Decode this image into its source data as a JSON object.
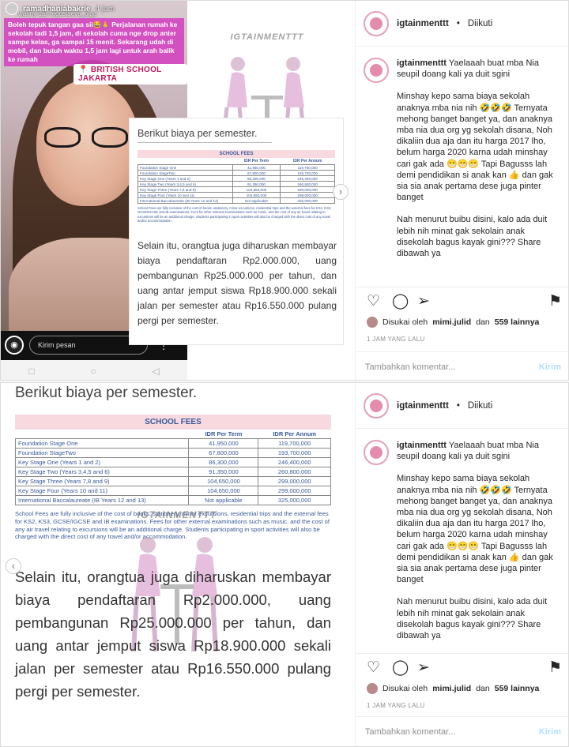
{
  "story": {
    "username": "ramadhaniabakrie",
    "time": "4 jam",
    "tagged": "wanny dan legostaeva_olga",
    "caption": "Boleh tepuk tangan gaa sii😂🙏 Perjalanan rumah ke sekolah tadi 1,5 jam, di sekolah cuma nge drop anter sampe kelas, ga sampai 15 menit. Sekarang udah di mobil, dan butuh waktu 1,5 jam lagi untuk arah balik ke rumah",
    "location": "📍 BRITISH SCHOOL JAKARTA",
    "message_placeholder": "Kirim pesan",
    "camera_icon": "◉",
    "more_icon": "⋮",
    "nav_back": "◁",
    "nav_home": "○",
    "nav_recent": "□"
  },
  "doc": {
    "heading": "Berikut biaya per semester.",
    "fees_title": "SCHOOL FEES",
    "col_term": "IDR Per Term",
    "col_annum": "IDR Per Annum",
    "rows": [
      {
        "stage": "Foundation Stage One",
        "term": "41,950,000",
        "annum": "119,700,000"
      },
      {
        "stage": "Foundation StageTwo",
        "term": "67,800,000",
        "annum": "193,700,000"
      },
      {
        "stage": "Key Stage One (Years 1 and 2)",
        "term": "86,300,000",
        "annum": "246,400,000"
      },
      {
        "stage": "Key Stage Two (Years 3,4,5 and 6)",
        "term": "91,350,000",
        "annum": "260,800,000"
      },
      {
        "stage": "Key Stage Three (Years 7,8 and 9)",
        "term": "104,650,000",
        "annum": "299,000,000"
      },
      {
        "stage": "Key Stage Four (Years 10 and 11)",
        "term": "104,650,000",
        "annum": "299,000,000"
      },
      {
        "stage": "International Baccalaureate (IB Years 12 and 13)",
        "term": "Not applicable",
        "annum": "325,000,000"
      }
    ],
    "note": "School Fees are fully inclusive of the cost of books, stationery, minor excursions, residential trips and the external fees for KS2, KS3, GCSE/IGCSE and IB examinations. Fees for other external examinations such as music, and the cost of any air travel relating to excursions will be an additional charge. Students participating in sport activities will also be charged with the direct cost of any travel and/or accommodation.",
    "body": "Selain itu, orangtua juga diharuskan membayar biaya pendaftaran Rp2.000.000, uang pembangunan Rp25.000.000 per tahun, dan uang antar jemput siswa Rp18.900.000 sekali jalan per semester atau Rp16.550.000 pulang pergi per semester.",
    "watermark": "IGTAINMENTTT"
  },
  "post": {
    "username": "igtainmenttt",
    "dot": "•",
    "follow_status": "Diikuti",
    "caption_paragraphs": [
      "Yaelaaah buat mba Nia seupil doang kali ya duit sgini",
      "Minshay kepo sama biaya sekolah anaknya mba nia nih 🤣🤣🤣 Ternyata mehong banget banget ya, dan anaknya mba nia dua org yg sekolah disana, Noh dikaliin dua aja dan itu harga 2017 lho, belum harga 2020 karna udah minshay cari gak ada 😁😁😁 Tapi Bagusss lah demi pendidikan si anak kan 👍 dan gak sia sia anak pertama dese juga pinter banget",
      "Nah menurut buibu disini, kalo ada duit lebih nih minat gak sekolain anak disekolah bagus kayak gini??? Share dibawah ya"
    ],
    "likes_prefix": "Disukai oleh",
    "likes_user": "mimi.julid",
    "likes_and": "dan",
    "likes_count": "559 lainnya",
    "time": "1 JAM YANG LALU",
    "comment_placeholder": "Tambahkan komentar...",
    "send_label": "Kirim",
    "icons": {
      "like": "♡",
      "comment": "◯",
      "share": "➢",
      "save": "⚑"
    }
  },
  "arrows": {
    "next": "›",
    "prev": "‹"
  }
}
